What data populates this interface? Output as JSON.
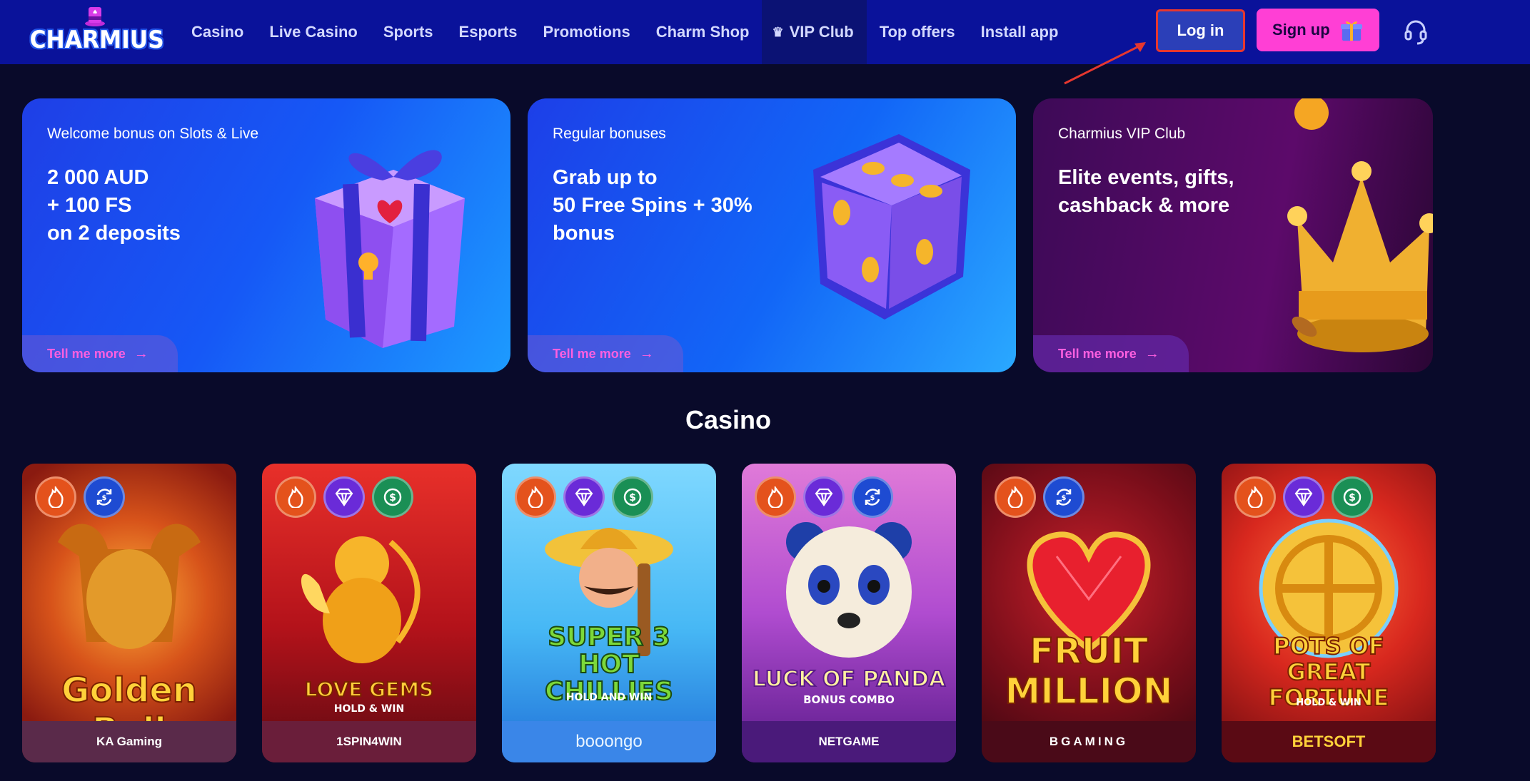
{
  "header": {
    "logo_text": "CHARMIUS",
    "nav": [
      "Casino",
      "Live Casino",
      "Sports",
      "Esports",
      "Promotions",
      "Charm Shop",
      "VIP Club",
      "Top offers",
      "Install app"
    ],
    "login_label": "Log in",
    "signup_label": "Sign up",
    "colors": {
      "bar": "#0a129a",
      "login": "#2b3fb8",
      "signup": "#ff3fd5",
      "highlight": "#e6372f"
    }
  },
  "promos": [
    {
      "kicker": "Welcome bonus on Slots & Live",
      "headline": "2 000 AUD\n+ 100 FS\non 2 deposits",
      "cta": "Tell me more",
      "art_icon": "gift-box-icon"
    },
    {
      "kicker": "Regular bonuses",
      "headline": "Grab up to\n50 Free Spins + 30%\nbonus",
      "cta": "Tell me more",
      "art_icon": "dice-icon"
    },
    {
      "kicker": "Charmius VIP Club",
      "headline": "Elite events, gifts,\ncashback & more",
      "cta": "Tell me more",
      "art_icon": "crown-icon"
    }
  ],
  "casino": {
    "title": "Casino",
    "games": [
      {
        "name": "Golden Bull",
        "provider": "KA Gaming",
        "badges": [
          "fire-icon",
          "swap-icon"
        ]
      },
      {
        "name": "LOVE GEMS",
        "subtitle": "HOLD & WIN",
        "provider": "1SPIN4WIN",
        "badges": [
          "fire-icon",
          "gem-icon",
          "cash-icon"
        ]
      },
      {
        "name": "SUPER 3 HOT CHILLIES",
        "subtitle": "HOLD AND WIN",
        "provider": "booongo",
        "badges": [
          "fire-icon",
          "gem-icon",
          "cash-icon"
        ]
      },
      {
        "name": "LUCK OF PANDA",
        "subtitle": "BONUS COMBO",
        "provider": "NETGAME",
        "badges": [
          "fire-icon",
          "gem-icon",
          "swap-icon"
        ]
      },
      {
        "name": "FRUIT MILLION",
        "provider": "BGAMING",
        "badges": [
          "fire-icon",
          "swap-icon"
        ]
      },
      {
        "name": "POTS OF GREAT FORTUNE",
        "subtitle": "HOLD & WIN",
        "provider": "BETSOFT",
        "badges": [
          "fire-icon",
          "gem-icon",
          "cash-icon"
        ]
      }
    ]
  }
}
